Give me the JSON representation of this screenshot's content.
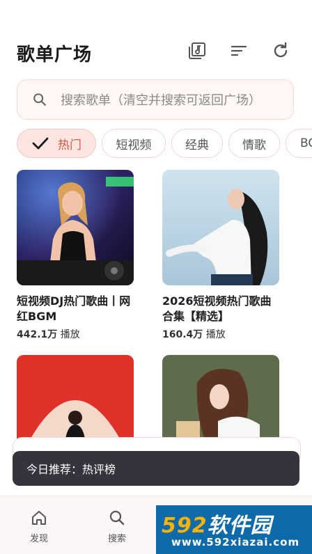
{
  "header": {
    "title": "歌单广场",
    "icons": [
      "playlist-library-icon",
      "sort-icon",
      "refresh-icon"
    ]
  },
  "search": {
    "placeholder": "搜索歌单（清空并搜索可返回广场）"
  },
  "chips": [
    {
      "label": "热门",
      "active": true
    },
    {
      "label": "短视频",
      "active": false
    },
    {
      "label": "经典",
      "active": false
    },
    {
      "label": "情歌",
      "active": false
    },
    {
      "label": "BG",
      "active": false
    }
  ],
  "playlists": [
    {
      "title": "短视频DJ热门歌曲丨网红BGM",
      "plays": "442.1万",
      "plays_suffix": "播放"
    },
    {
      "title": "2026短视频热门歌曲合集【精选】",
      "plays": "160.4万",
      "plays_suffix": "播放"
    },
    {
      "title": "",
      "plays": "",
      "plays_suffix": ""
    },
    {
      "title": "",
      "plays": "",
      "plays_suffix": ""
    }
  ],
  "toast": {
    "text": "今日推荐：热评榜"
  },
  "bottom_nav": [
    {
      "label": "发现",
      "icon": "home-icon"
    },
    {
      "label": "搜索",
      "icon": "search-icon"
    }
  ],
  "watermark": {
    "brand_num": "592",
    "brand_text": "软件园",
    "url": "www.592xiazai.com"
  },
  "colors": {
    "accent": "#e05545",
    "chip_active_bg": "#fde6e2",
    "toast_bg": "#34343c"
  }
}
